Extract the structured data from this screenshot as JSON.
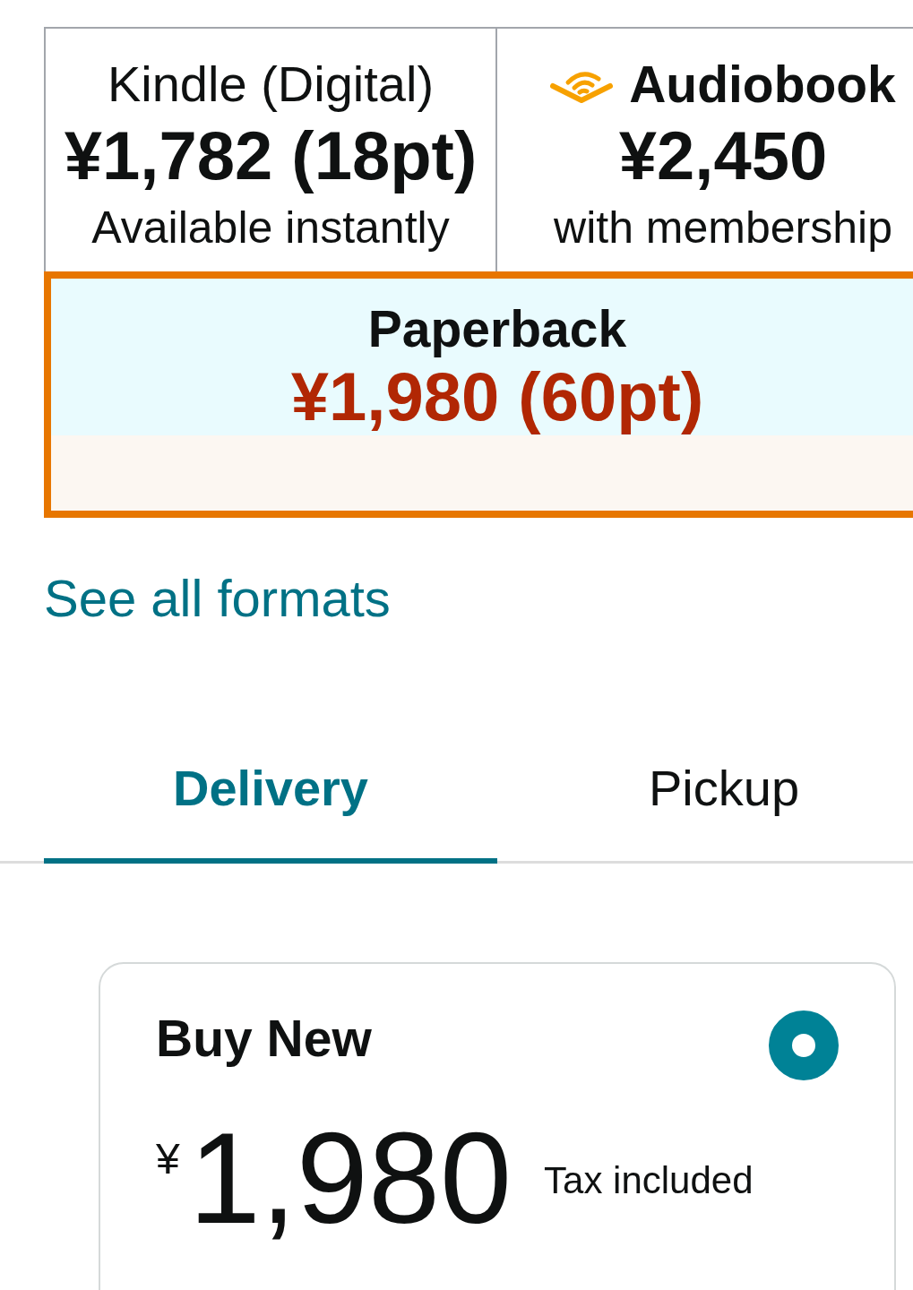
{
  "formats": [
    {
      "kind": "digital",
      "title": "Kindle (Digital)",
      "price": "¥1,782 (18pt)",
      "note": "Available instantly",
      "selected": false
    },
    {
      "kind": "audio",
      "title": "Audiobook",
      "price": "¥2,450",
      "note": "with membership",
      "selected": false
    },
    {
      "kind": "print",
      "title": "Paperback",
      "price": "¥1,980 (60pt)",
      "selected": true
    }
  ],
  "see_all_link": "See all formats",
  "tabs": [
    {
      "label": "Delivery",
      "selected": true
    },
    {
      "label": "Pickup",
      "selected": false
    }
  ],
  "offer": {
    "title": "Buy New",
    "selected": true,
    "currency": "¥",
    "amount": "1,980",
    "tax_note": "Tax included"
  }
}
